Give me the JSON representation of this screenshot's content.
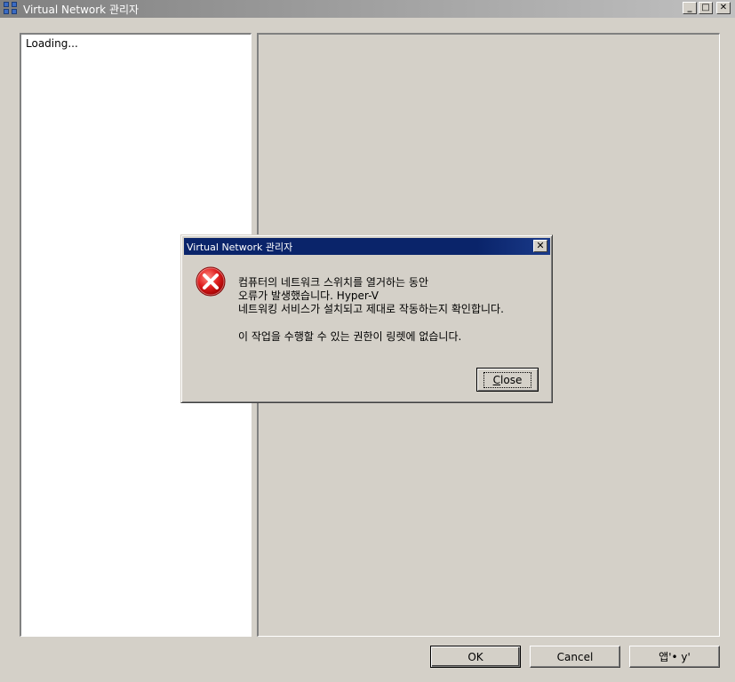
{
  "window": {
    "title": "Virtual Network 관리자",
    "minimize_label": "_",
    "maximize_label": "□",
    "close_label": "✕"
  },
  "left_pane": {
    "status_text": "Loading..."
  },
  "buttons": {
    "ok_label": "OK",
    "cancel_label": "Cancel",
    "apply_label": "앱'• y'"
  },
  "dialog": {
    "title": "Virtual Network 관리자",
    "close_x_label": "✕",
    "message_line1": "컴퓨터의 네트워크 스위치를 열거하는 동안",
    "message_line2": "오류가 발생했습니다. Hyper-V",
    "message_line3": "네트워킹 서비스가 설치되고 제대로 작동하는지 확인합니다.",
    "message_line4": "이 작업을 수행할 수 있는 권한이 링렛에 없습니다.",
    "close_button_accel": "C",
    "close_button_rest": "lose",
    "icon": "error-icon"
  }
}
